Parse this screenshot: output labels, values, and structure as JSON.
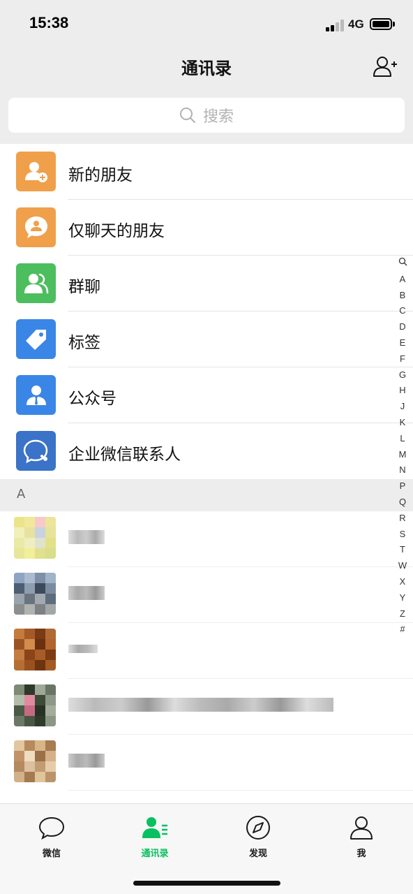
{
  "status": {
    "time": "15:38",
    "network": "4G"
  },
  "nav": {
    "title": "通讯录"
  },
  "search": {
    "placeholder": "搜索"
  },
  "menu": [
    {
      "label": "新的朋友",
      "icon": "new-friend-icon",
      "color": "#f0a04b"
    },
    {
      "label": "仅聊天的朋友",
      "icon": "chat-only-icon",
      "color": "#f0a04b"
    },
    {
      "label": "群聊",
      "icon": "group-chat-icon",
      "color": "#4cbe5e"
    },
    {
      "label": "标签",
      "icon": "tag-icon",
      "color": "#3a86e6"
    },
    {
      "label": "公众号",
      "icon": "official-account-icon",
      "color": "#3a86e6"
    },
    {
      "label": "企业微信联系人",
      "icon": "wecom-contacts-icon",
      "color": "#3a73c7"
    }
  ],
  "section": {
    "letter": "A"
  },
  "index": [
    "Q",
    "A",
    "B",
    "C",
    "D",
    "E",
    "F",
    "G",
    "H",
    "J",
    "K",
    "L",
    "M",
    "N",
    "P",
    "Q",
    "R",
    "S",
    "T",
    "W",
    "X",
    "Y",
    "Z",
    "#"
  ],
  "tabs": [
    {
      "label": "微信",
      "icon": "chats-icon",
      "active": false
    },
    {
      "label": "通讯录",
      "icon": "contacts-icon",
      "active": true
    },
    {
      "label": "发现",
      "icon": "discover-icon",
      "active": false
    },
    {
      "label": "我",
      "icon": "me-icon",
      "active": false
    }
  ],
  "colors": {
    "accent": "#07c160",
    "background": "#ededed"
  }
}
